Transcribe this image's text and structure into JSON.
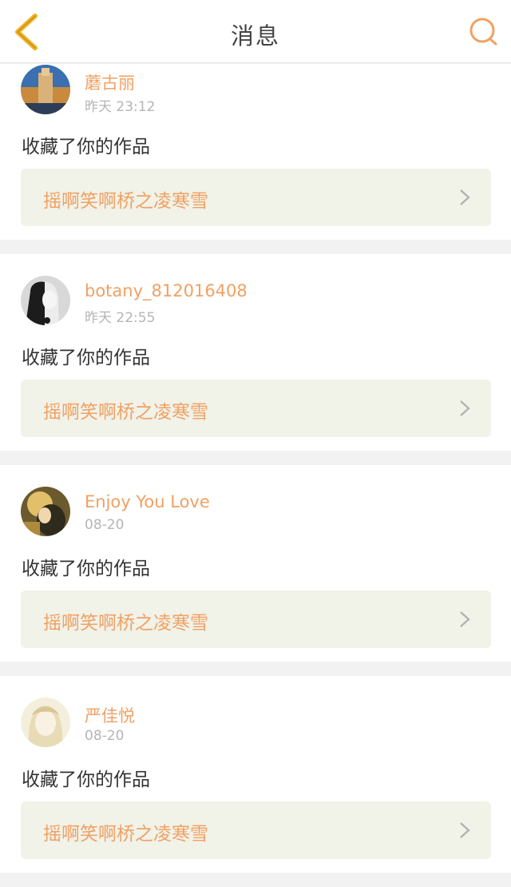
{
  "colors": {
    "accent": "#f0a164",
    "back_arrow": "#f0b323",
    "time": "#b5b5b5",
    "text": "#333333",
    "card_bg": "#f1f2e8"
  },
  "header": {
    "title": "消息",
    "back_icon": "chevron-left-icon",
    "search_icon": "search-icon"
  },
  "messages": [
    {
      "user": "蘑古丽",
      "time": "昨天 23:12",
      "action": "收藏了你的作品",
      "work_title": "摇啊笑啊桥之凌寒雪"
    },
    {
      "user": "botany_812016408",
      "time": "昨天 22:55",
      "action": "收藏了你的作品",
      "work_title": "摇啊笑啊桥之凌寒雪"
    },
    {
      "user": "Enjoy You Love",
      "time": "08-20",
      "action": "收藏了你的作品",
      "work_title": "摇啊笑啊桥之凌寒雪"
    },
    {
      "user": "严佳悦",
      "time": "08-20",
      "action": "收藏了你的作品",
      "work_title": "摇啊笑啊桥之凌寒雪"
    }
  ]
}
